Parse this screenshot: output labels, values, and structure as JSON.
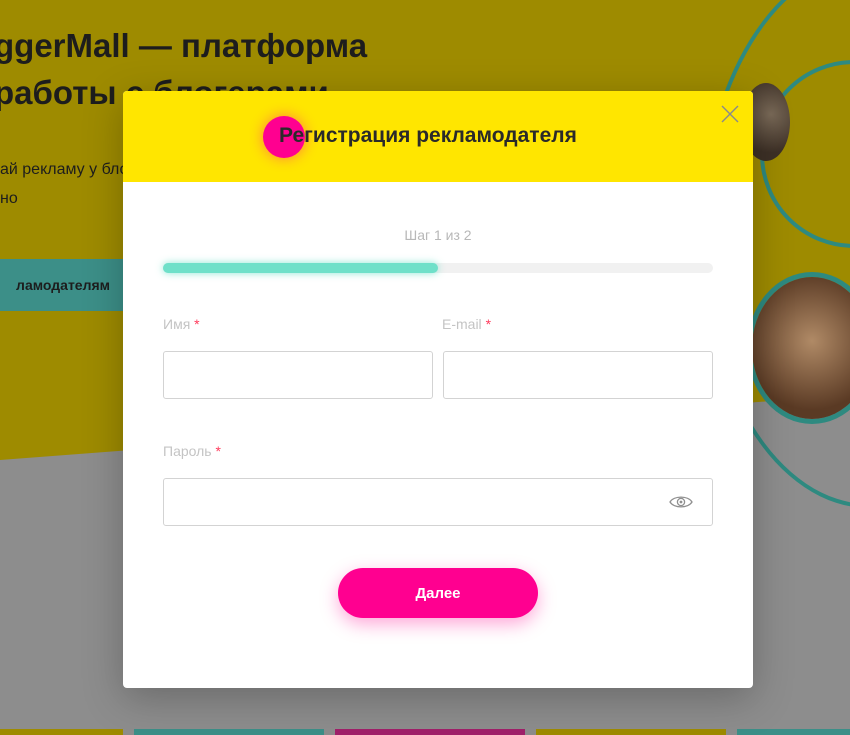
{
  "background": {
    "hero_title_line1": "ggerMall — платформа",
    "hero_title_line2": "работы с блогерами",
    "hero_sub_line1": "ай рекламу у бло",
    "hero_sub_line2": "но",
    "cta_label": "ламодателям"
  },
  "modal": {
    "title": "Регистрация рекламодателя",
    "step_text": "Шаг 1 из 2",
    "progress": 0.5,
    "name_label": "Имя",
    "email_label": "E-mail",
    "password_label": "Пароль",
    "required_mark": "*",
    "name_value": "",
    "email_value": "",
    "password_value": "",
    "next_label": "Далее"
  },
  "colors": {
    "header_yellow": "#ffe600",
    "accent_pink": "#ff0090",
    "progress_teal": "#6fe0c9"
  },
  "icons": {
    "close": "close-icon",
    "password_toggle": "eye-icon"
  }
}
